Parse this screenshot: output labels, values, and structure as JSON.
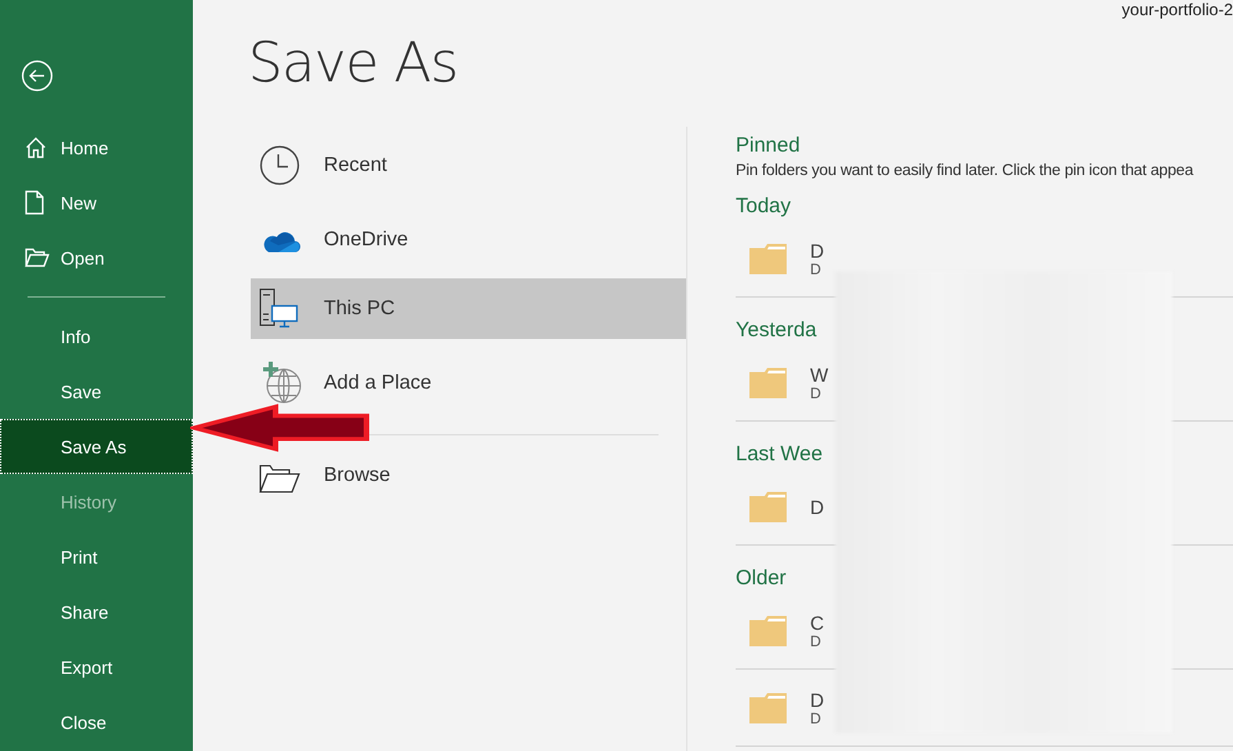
{
  "window": {
    "filename": "your-portfolio-2"
  },
  "sidebar": {
    "top_items": [
      {
        "label": "Home",
        "kind": "home",
        "selected": false,
        "disabled": false
      },
      {
        "label": "New",
        "kind": "new",
        "selected": false,
        "disabled": false
      },
      {
        "label": "Open",
        "kind": "open",
        "selected": false,
        "disabled": false
      }
    ],
    "bottom_items": [
      {
        "label": "Info",
        "selected": false,
        "disabled": false
      },
      {
        "label": "Save",
        "selected": false,
        "disabled": false
      },
      {
        "label": "Save As",
        "selected": true,
        "disabled": false
      },
      {
        "label": "History",
        "selected": false,
        "disabled": true
      },
      {
        "label": "Print",
        "selected": false,
        "disabled": false
      },
      {
        "label": "Share",
        "selected": false,
        "disabled": false
      },
      {
        "label": "Export",
        "selected": false,
        "disabled": false
      },
      {
        "label": "Close",
        "selected": false,
        "disabled": false
      }
    ]
  },
  "page_title": "Save As",
  "locations": [
    {
      "label": "Recent",
      "kind": "recent",
      "selected": false
    },
    {
      "label": "OneDrive",
      "kind": "onedrive",
      "selected": false
    },
    {
      "label": "This PC",
      "kind": "pc",
      "selected": true
    },
    {
      "label": "Add a Place",
      "kind": "add",
      "selected": false
    },
    {
      "label": "Browse",
      "kind": "browse",
      "selected": false
    }
  ],
  "folders": {
    "pinned": {
      "heading": "Pinned",
      "description": "Pin folders you want to easily find later. Click the pin icon that appea"
    },
    "groups": [
      {
        "heading": "Today",
        "items": [
          {
            "name": "D",
            "path": "D"
          }
        ]
      },
      {
        "heading": "Yesterda",
        "items": [
          {
            "name": "W",
            "path": "D"
          }
        ]
      },
      {
        "heading": "Last Wee",
        "items": [
          {
            "name": "D"
          }
        ]
      },
      {
        "heading": "Older",
        "items": [
          {
            "name": "C",
            "path": "D"
          },
          {
            "name": "D",
            "path": "D"
          }
        ]
      }
    ]
  }
}
